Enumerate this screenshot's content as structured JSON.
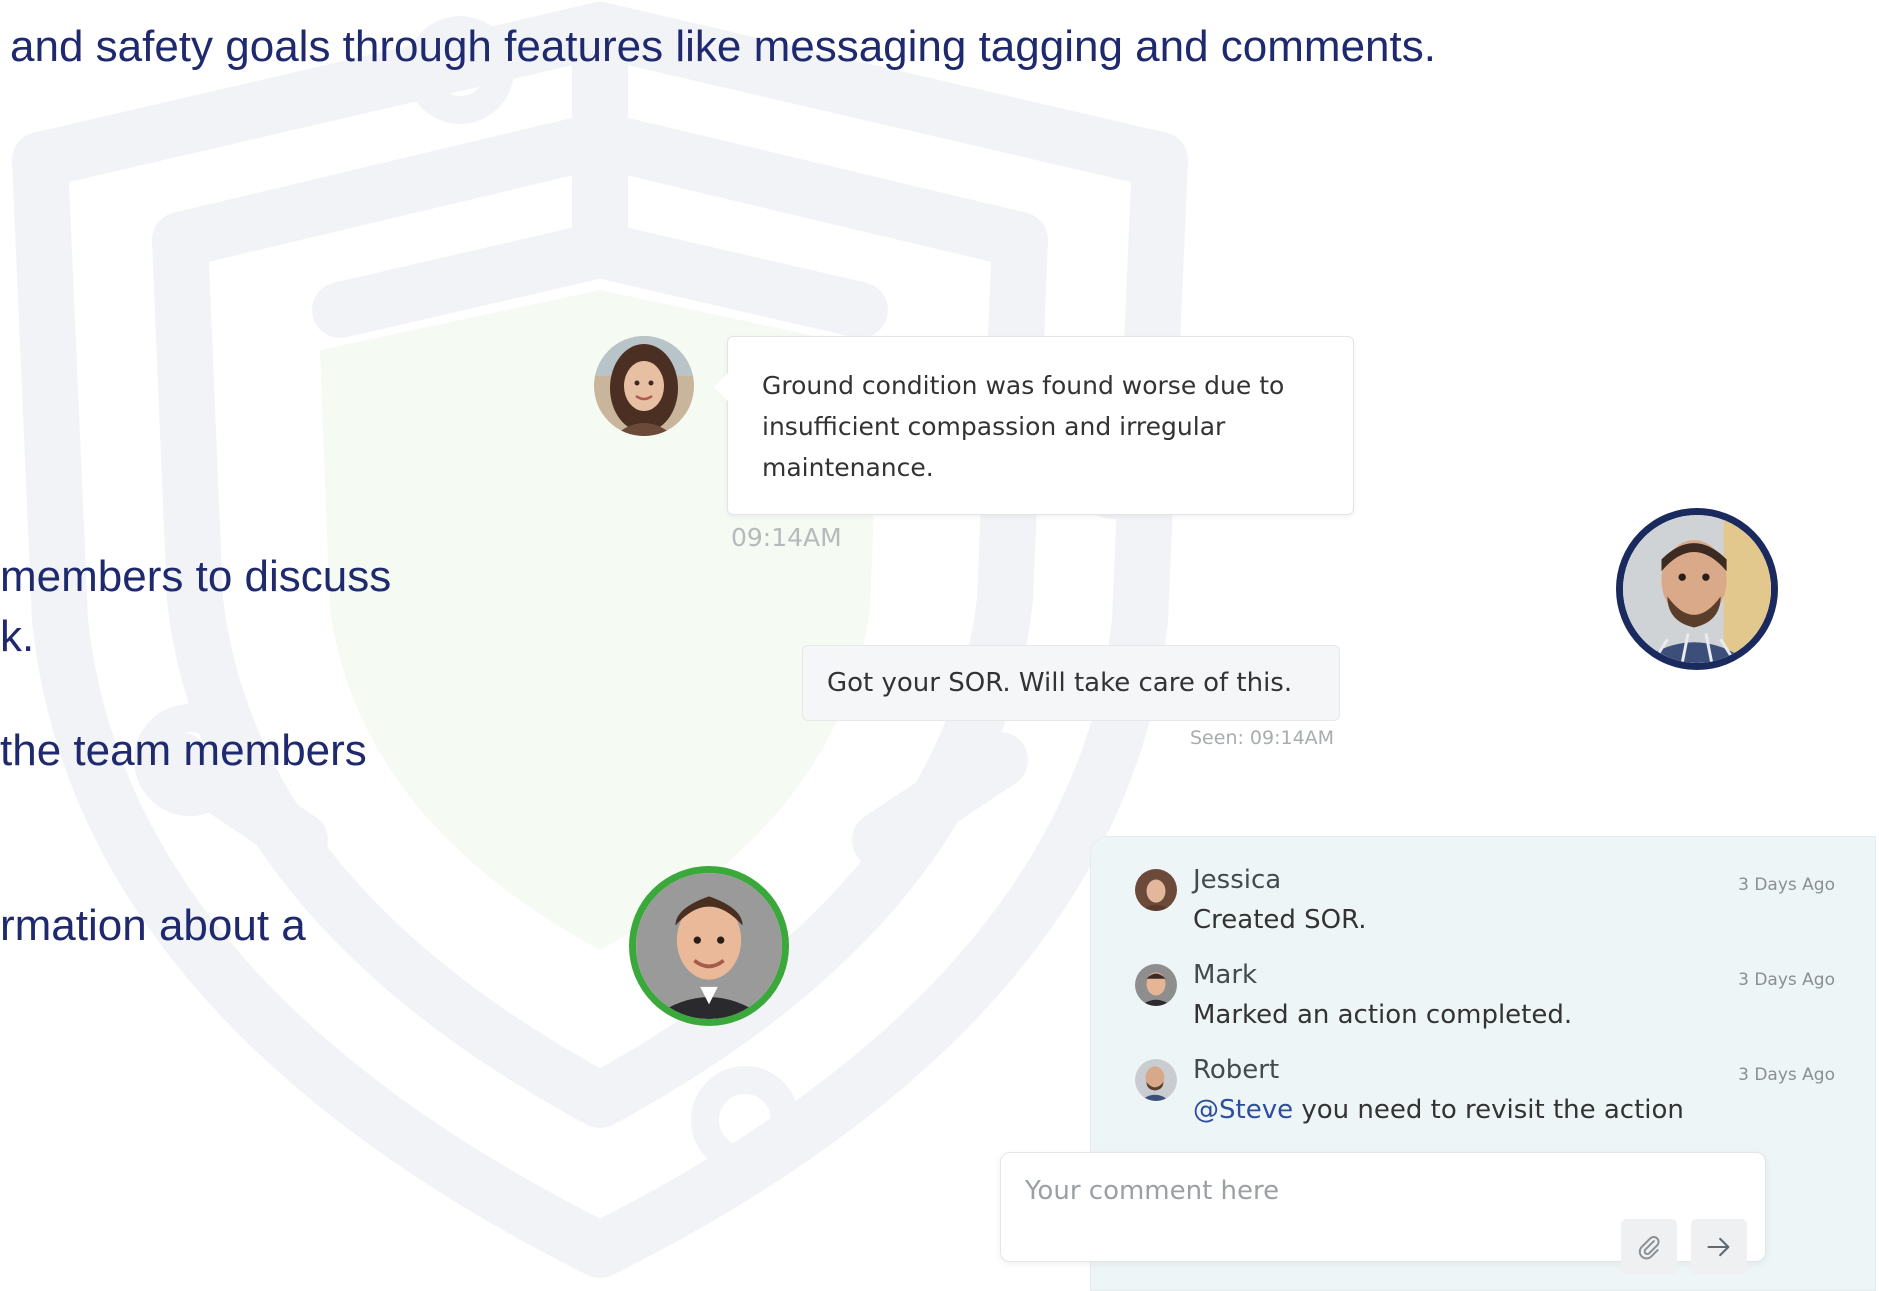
{
  "intro": {
    "text": "and safety goals through features like messaging tagging and comments."
  },
  "left_lines": [
    "members to discuss",
    "k.",
    "the team members",
    "rmation about a"
  ],
  "chat": {
    "incoming": {
      "text": "Ground condition was found worse due to insufficient compassion and irregular maintenance.",
      "time": "09:14AM"
    },
    "outgoing": {
      "text": "Got  your SOR. Will take care of this.",
      "seen": "Seen: 09:14AM"
    }
  },
  "activity": [
    {
      "name": "Jessica",
      "time": "3 Days Ago",
      "text": "Created SOR.",
      "mention": ""
    },
    {
      "name": "Mark",
      "time": "3 Days Ago",
      "text": "Marked an action completed.",
      "mention": ""
    },
    {
      "name": "Robert",
      "time": "3 Days Ago",
      "text": " you need to revisit the action",
      "mention": "@Steve"
    }
  ],
  "comment": {
    "placeholder": "Your comment here"
  },
  "colors": {
    "heading": "#1f2a6e",
    "avatar_ring_navy": "#1b2a5e",
    "avatar_ring_green": "#3aa83a",
    "panel_bg": "#eef5f6",
    "mention": "#2d4e9e"
  },
  "icons": [
    "attach-icon",
    "send-arrow-icon"
  ]
}
